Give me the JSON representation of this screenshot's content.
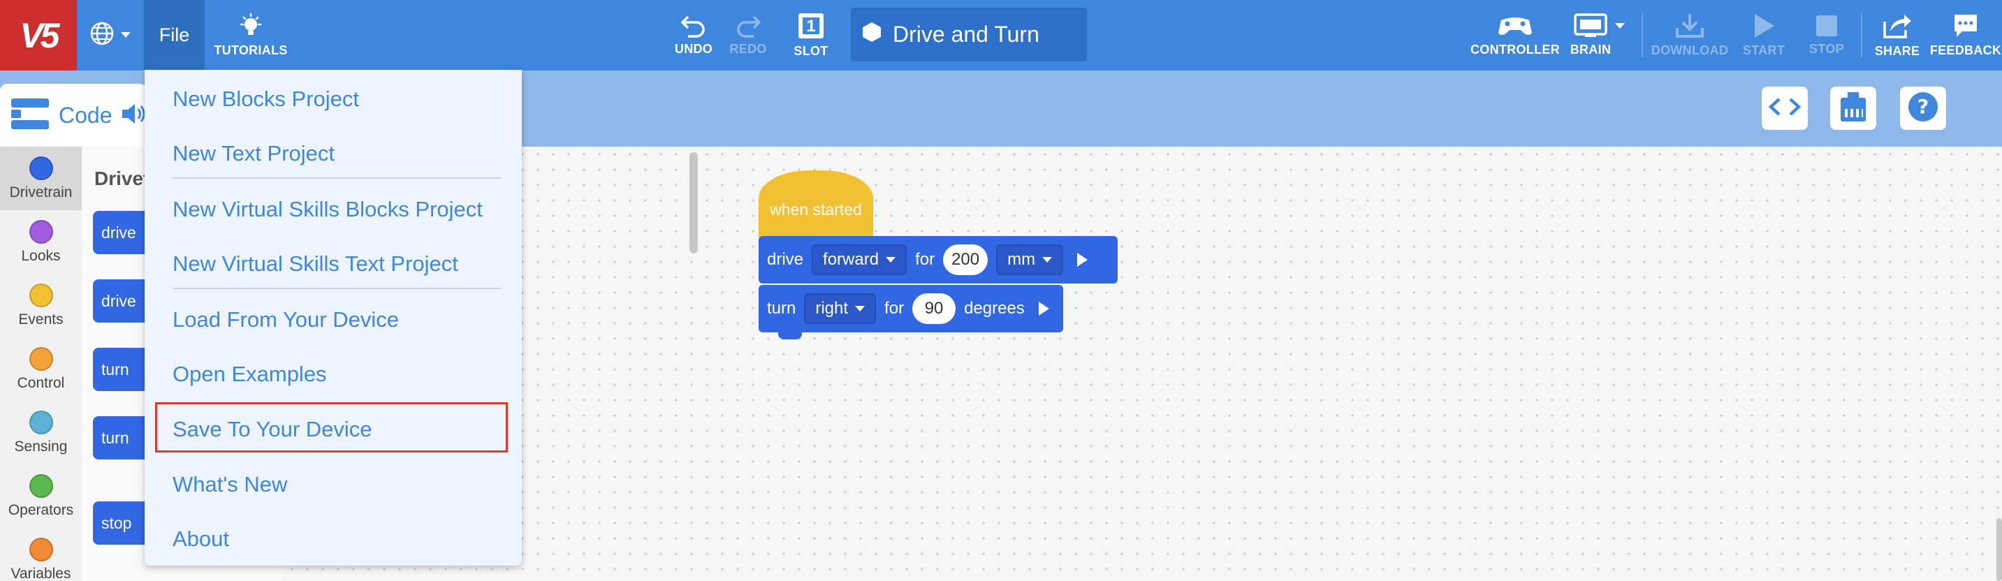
{
  "toolbar": {
    "logo": "V5",
    "file_label": "File",
    "tutorials_label": "TUTORIALS",
    "undo_label": "UNDO",
    "redo_label": "REDO",
    "slot_label": "SLOT",
    "slot_number": "1",
    "project_name": "Drive and Turn",
    "controller_label": "CONTROLLER",
    "brain_label": "BRAIN",
    "download_label": "DOWNLOAD",
    "start_label": "START",
    "stop_label": "STOP",
    "share_label": "SHARE",
    "feedback_label": "FEEDBACK"
  },
  "subbar": {
    "code_label": "Code"
  },
  "categories": [
    {
      "label": "Drivetrain",
      "color": "#3267e3"
    },
    {
      "label": "Looks",
      "color": "#a25ce0"
    },
    {
      "label": "Events",
      "color": "#f2c133"
    },
    {
      "label": "Control",
      "color": "#f4a338"
    },
    {
      "label": "Sensing",
      "color": "#5cb1d6"
    },
    {
      "label": "Operators",
      "color": "#59b94c"
    },
    {
      "label": "Variables",
      "color": "#f08a34"
    }
  ],
  "palette": {
    "title": "Drivet",
    "blocks": [
      "drive",
      "drive",
      "turn",
      "turn",
      "stop"
    ]
  },
  "workspace": {
    "hat_label": "when started",
    "drive_block": {
      "verb": "drive",
      "direction": "forward",
      "for": "for",
      "value": "200",
      "unit": "mm"
    },
    "turn_block": {
      "verb": "turn",
      "direction": "right",
      "for": "for",
      "value": "90",
      "unit": "degrees"
    }
  },
  "file_menu": {
    "items": [
      "New Blocks Project",
      "New Text Project",
      "New Virtual Skills Blocks Project",
      "New Virtual Skills Text Project",
      "Load From Your Device",
      "Open Examples",
      "Save To Your Device",
      "What's New",
      "About"
    ],
    "highlighted_item": "Save To Your Device"
  },
  "colors": {
    "toolbar": "#3f87dd",
    "subbar": "#8fb8ea",
    "logo": "#cf2e2e",
    "block_blue": "#3267e3",
    "hat_yellow": "#f2c133",
    "highlight_red": "#e03a2b"
  }
}
